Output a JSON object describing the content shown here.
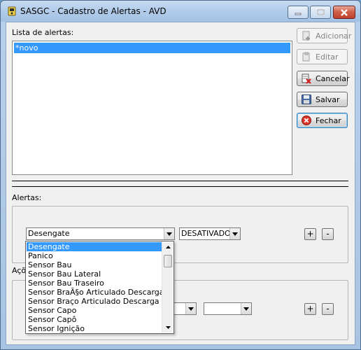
{
  "window": {
    "title": "SASGC - Cadastro de Alertas - AVD"
  },
  "lista": {
    "label": "Lista de alertas:",
    "items": [
      "*novo"
    ]
  },
  "buttons": {
    "adicionar": "Adicionar",
    "editar": "Editar",
    "cancelar": "Cancelar",
    "salvar": "Salvar",
    "fechar": "Fechar"
  },
  "alertas": {
    "label": "Alertas:",
    "sensor_value": "Desengate",
    "status_value": "DESATIVADO",
    "add": "+",
    "remove": "-"
  },
  "acoes": {
    "label_visible": "Açõ",
    "add": "+",
    "remove": "-"
  },
  "dropdown": {
    "options": [
      "Desengate",
      "Panico",
      "Sensor Bau",
      "Sensor Bau Lateral",
      "Sensor Bau Traseiro",
      "Sensor BraÃ§o Articulado Descarga",
      "Sensor Braço Articulado Descarga",
      "Sensor Capo",
      "Sensor Capô",
      "Sensor Ignição"
    ],
    "selected_index": 0
  }
}
